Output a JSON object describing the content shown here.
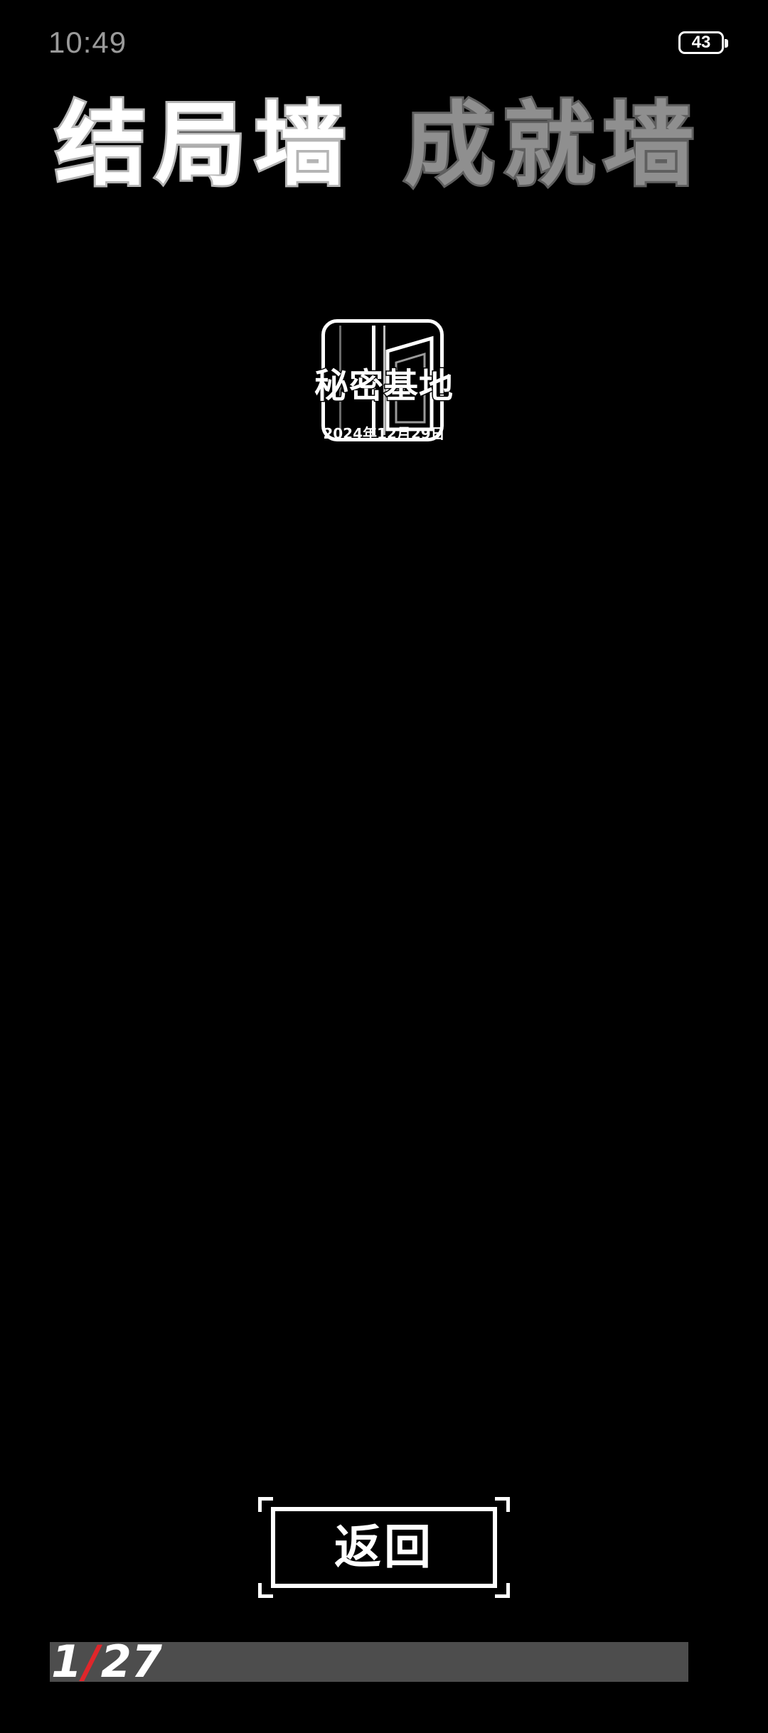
{
  "status_bar": {
    "time": "10:49",
    "battery": "43"
  },
  "tabs": [
    {
      "label": "结局墙",
      "active": true
    },
    {
      "label": "成就墙",
      "active": false
    }
  ],
  "endings": [
    {
      "title": "秘密基地",
      "date": "2024年12月29日",
      "icon": "door-icon"
    }
  ],
  "back_button": {
    "label": "返回"
  },
  "pager": {
    "current": "1",
    "separator": "/",
    "total": "27",
    "accent_color": "#e0262b"
  }
}
